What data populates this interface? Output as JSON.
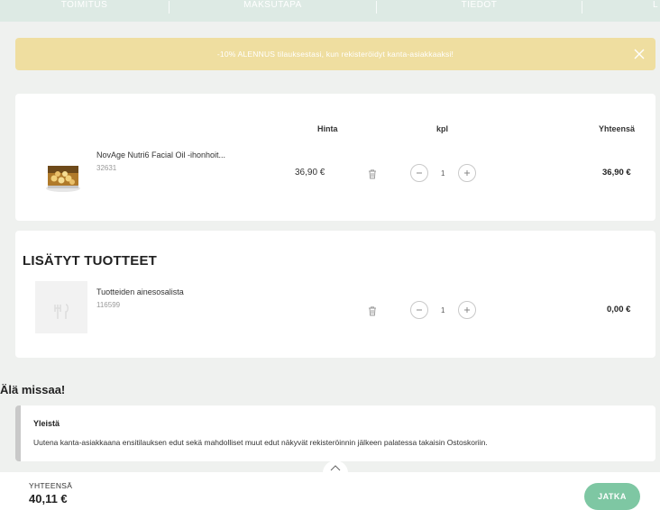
{
  "stepper": {
    "steps": [
      "TOIMITUS",
      "MAKSUTAPA",
      "TIEDOT",
      "L"
    ]
  },
  "banner": {
    "text": "-10% ALENNUS tilauksestasi, kun rekisteröidyt kanta-asiakkaaksi!"
  },
  "cart": {
    "columns": {
      "price": "Hinta",
      "qty": "kpl",
      "total": "Yhteensä"
    },
    "items": [
      {
        "name": "NovAge Nutri6 Facial Oil -ihonhoit...",
        "id": "32631",
        "price": "36,90 €",
        "qty": "1",
        "total": "36,90 €"
      }
    ]
  },
  "added": {
    "title": "LISÄTYT TUOTTEET",
    "items": [
      {
        "name": "Tuotteiden ainesosalista",
        "id": "116599",
        "qty": "1",
        "total": "0,00 €"
      }
    ]
  },
  "dont_miss": {
    "title": "Älä missaa!",
    "card_title": "Yleistä",
    "card_body": "Uutena kanta-asiakkaana ensitilauksen edut sekä mahdolliset muut edut näkyvät rekisteröinnin jälkeen palatessa takaisin Ostoskoriin."
  },
  "footer": {
    "label": "YHTEENSÄ",
    "amount": "40,11 €",
    "continue": "JATKA"
  },
  "colors": {
    "background": "#eff1ef",
    "banner": "#efdea0",
    "accent": "#7ec7a3",
    "stepper": "#ddeae4"
  },
  "icons": [
    "close-icon",
    "trash-icon",
    "minus-icon",
    "plus-icon",
    "chevron-up-icon",
    "placeholder-image-icon"
  ]
}
